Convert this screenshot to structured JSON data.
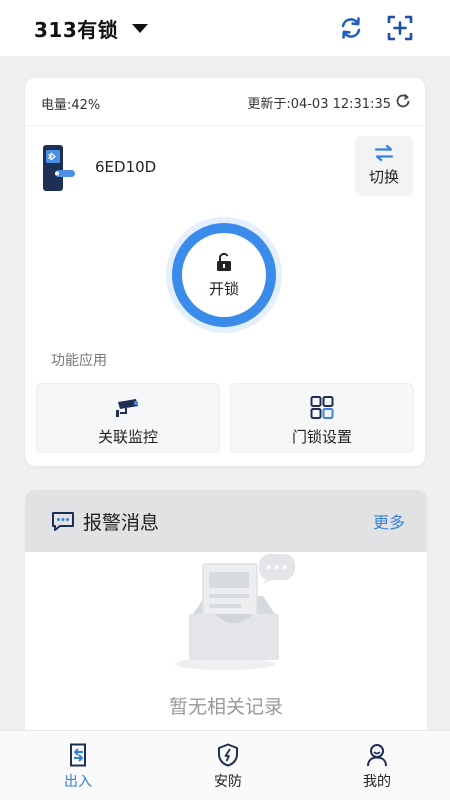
{
  "header": {
    "title": "313有锁",
    "dropdown_icon": "caret-down-icon",
    "refresh_icon": "refresh-icon",
    "scan_icon": "scan-add-icon"
  },
  "lock_card": {
    "battery": "电量:42%",
    "updated": "更新于:04-03 12:31:35",
    "device_icon": "phone-bluetooth-icon",
    "device_name": "6ED10D",
    "switch_label": "切换",
    "unlock_label": "开锁",
    "function_title": "功能应用",
    "functions": [
      {
        "label": "关联监控",
        "icon": "camera-icon"
      },
      {
        "label": "门锁设置",
        "icon": "grid-icon"
      }
    ]
  },
  "alarm": {
    "title": "报警消息",
    "more": "更多",
    "empty_text": "暂无相关记录",
    "icon": "message-icon"
  },
  "bottom_nav": [
    {
      "label": "出入",
      "icon": "door-icon",
      "active": true
    },
    {
      "label": "安防",
      "icon": "shield-icon",
      "active": false
    },
    {
      "label": "我的",
      "icon": "user-icon",
      "active": false
    }
  ],
  "colors": {
    "accent": "#3b8bea",
    "link": "#3b82e0",
    "background": "#eeeff1"
  }
}
